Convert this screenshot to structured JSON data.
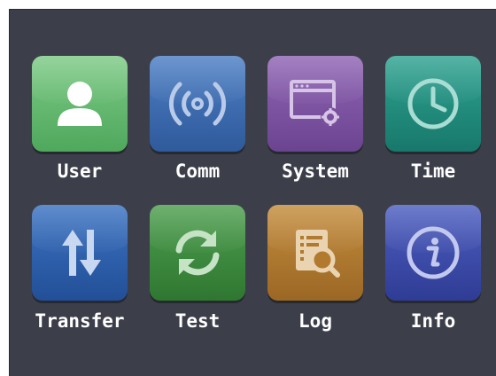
{
  "menu": {
    "tiles": [
      {
        "label": "User",
        "icon": "user-icon",
        "color": "#5fb86d"
      },
      {
        "label": "Comm",
        "icon": "wireless-signal-icon",
        "color": "#3a6ab0"
      },
      {
        "label": "System",
        "icon": "window-gear-icon",
        "color": "#7a4f9e"
      },
      {
        "label": "Time",
        "icon": "clock-icon",
        "color": "#1f8a7b"
      },
      {
        "label": "Transfer",
        "icon": "transfer-arrows-icon",
        "color": "#2a5dab"
      },
      {
        "label": "Test",
        "icon": "refresh-icon",
        "color": "#3c8a3e"
      },
      {
        "label": "Log",
        "icon": "log-search-icon",
        "color": "#b27a2e"
      },
      {
        "label": "Info",
        "icon": "info-icon",
        "color": "#3a4aa8"
      }
    ]
  }
}
